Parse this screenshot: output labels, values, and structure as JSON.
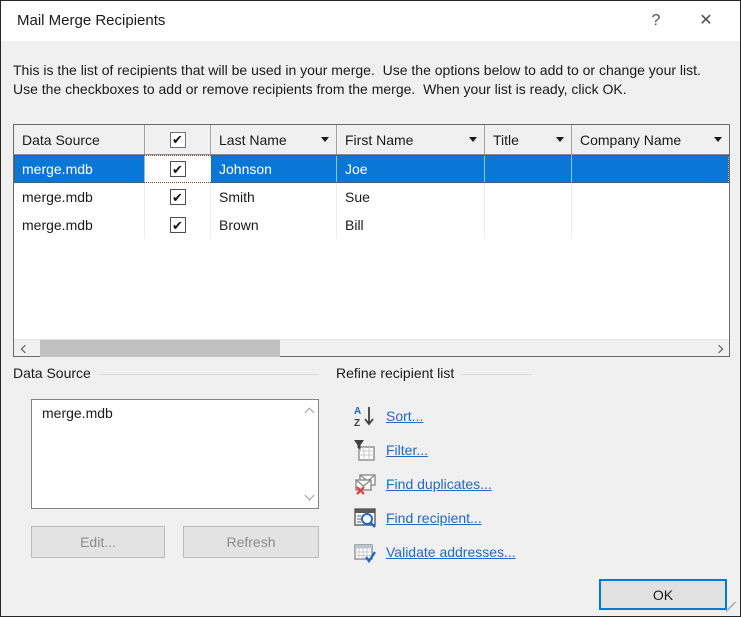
{
  "window": {
    "title": "Mail Merge Recipients",
    "help_glyph": "?",
    "close_glyph": "✕"
  },
  "description": "This is the list of recipients that will be used in your merge.  Use the options below to add to or change your list.  Use the checkboxes to add or remove recipients from the merge.  When your list is ready, click OK.",
  "table": {
    "columns": {
      "data_source": "Data Source",
      "last_name": "Last Name",
      "first_name": "First Name",
      "title": "Title",
      "company_name": "Company Name"
    },
    "rows": [
      {
        "data_source": "merge.mdb",
        "included": true,
        "last_name": "Johnson",
        "first_name": "Joe",
        "title": "",
        "company_name": "",
        "selected": true
      },
      {
        "data_source": "merge.mdb",
        "included": true,
        "last_name": "Smith",
        "first_name": "Sue",
        "title": "",
        "company_name": "",
        "selected": false
      },
      {
        "data_source": "merge.mdb",
        "included": true,
        "last_name": "Brown",
        "first_name": "Bill",
        "title": "",
        "company_name": "",
        "selected": false
      }
    ]
  },
  "data_source_group": {
    "label": "Data Source",
    "items": [
      "merge.mdb"
    ],
    "edit_label": "Edit...",
    "refresh_label": "Refresh"
  },
  "refine_group": {
    "label": "Refine recipient list",
    "links": [
      {
        "label": "Sort...",
        "icon": "sort-az-icon"
      },
      {
        "label": "Filter...",
        "icon": "filter-icon"
      },
      {
        "label": "Find duplicates...",
        "icon": "find-duplicates-icon"
      },
      {
        "label": "Find recipient...",
        "icon": "find-recipient-icon"
      },
      {
        "label": "Validate addresses...",
        "icon": "validate-addresses-icon"
      }
    ]
  },
  "ok_label": "OK",
  "icons": {
    "check": "✔"
  },
  "colors": {
    "selection": "#0a77d7",
    "link": "#2368c4",
    "accent_border": "#0078d7",
    "selected_text": "#ffffff"
  }
}
